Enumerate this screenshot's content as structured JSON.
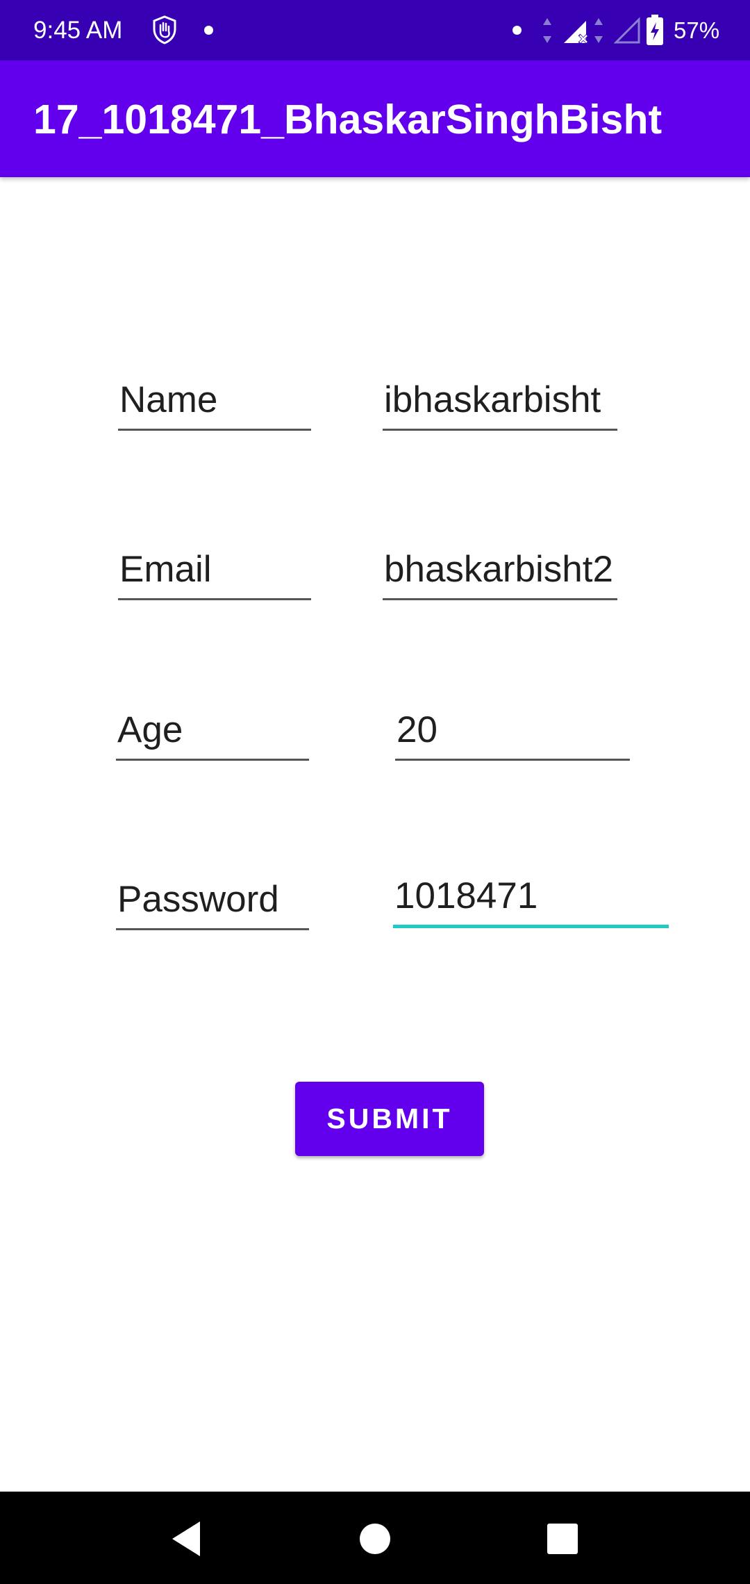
{
  "status_bar": {
    "time": "9:45 AM",
    "battery_percent": "57%",
    "icons": [
      "hand-shield-icon",
      "notification-dot-icon",
      "signal-dot-icon",
      "data-arrows-icon",
      "signal-no-service-icon",
      "signal-empty-icon",
      "battery-charging-icon"
    ]
  },
  "app_bar": {
    "title": "17_1018471_BhaskarSinghBisht",
    "color": "#6200ee"
  },
  "form": {
    "name_label": "Name",
    "name_value": "ibhaskarbisht",
    "email_label": "Email",
    "email_value": "bhaskarbisht2",
    "age_label": "Age",
    "age_value": "20",
    "password_label": "Password",
    "password_value": "1018471",
    "focus_color": "#1fcac4"
  },
  "submit": {
    "label": "SUBMIT"
  },
  "nav_bar": {
    "icons": [
      "back-icon",
      "home-icon",
      "recents-icon"
    ]
  }
}
